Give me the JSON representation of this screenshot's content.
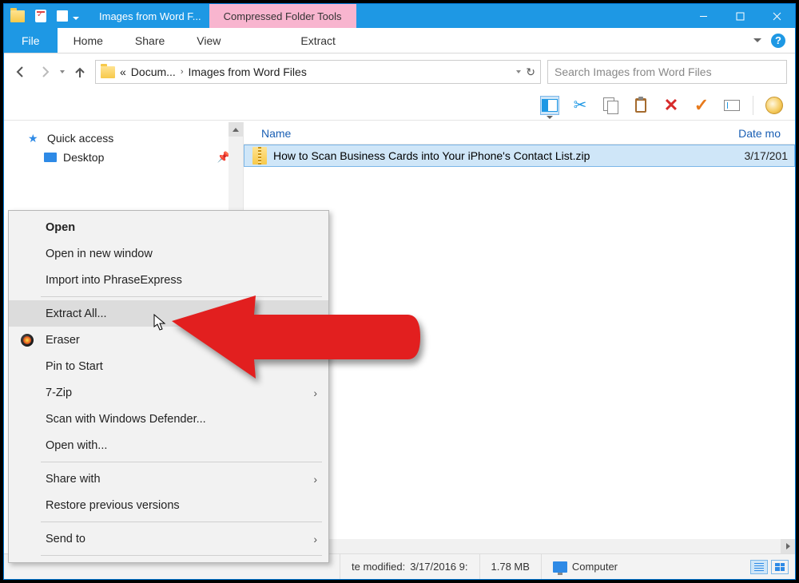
{
  "titlebar": {
    "title": "Images from Word F...",
    "contextual_tab": "Compressed Folder Tools"
  },
  "ribbon": {
    "file": "File",
    "tabs": [
      "Home",
      "Share",
      "View"
    ],
    "extract": "Extract"
  },
  "breadcrumb": {
    "prefix": "«",
    "seg1": "Docum...",
    "seg2": "Images from Word Files"
  },
  "search": {
    "placeholder": "Search Images from Word Files"
  },
  "sidebar": {
    "quick_access": "Quick access",
    "desktop": "Desktop"
  },
  "columns": {
    "name": "Name",
    "date": "Date mo"
  },
  "files": [
    {
      "name": "How to Scan Business Cards into Your iPhone's Contact List.zip",
      "date": "3/17/201"
    }
  ],
  "status": {
    "modified_label": "te modified:",
    "modified_value": "3/17/2016 9:",
    "size": "1.78 MB",
    "computer": "Computer"
  },
  "context_menu": {
    "open": "Open",
    "open_new": "Open in new window",
    "import_pe": "Import into PhraseExpress",
    "extract_all": "Extract All...",
    "eraser": "Eraser",
    "pin": "Pin to Start",
    "sevenzip": "7-Zip",
    "defender": "Scan with Windows Defender...",
    "open_with": "Open with...",
    "share_with": "Share with",
    "restore": "Restore previous versions",
    "send_to": "Send to"
  }
}
